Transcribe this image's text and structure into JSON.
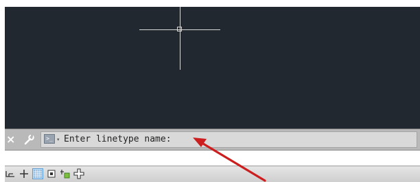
{
  "command_line": {
    "prompt_text": "Enter linetype name:",
    "close_label": "×",
    "prompt_icon_label": ">_",
    "dropdown_caret": "▾"
  },
  "colors": {
    "canvas_background": "#212830",
    "crosshair": "#d9d9d9",
    "annotation_arrow": "#cc1e1e"
  },
  "status_bar": {
    "buttons": [
      {
        "name": "snap-mode-icon"
      },
      {
        "name": "ortho-crosshair-icon"
      },
      {
        "name": "grid-display-icon"
      },
      {
        "name": "dynamic-input-icon"
      },
      {
        "name": "object-snap-tracking-icon"
      },
      {
        "name": "polar-tracking-icon"
      }
    ]
  }
}
